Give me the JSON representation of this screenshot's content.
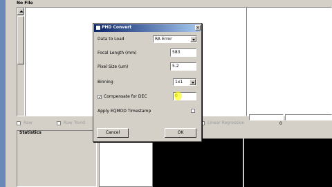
{
  "main": {
    "title": "No File",
    "checkboxes": [
      {
        "label": "Raw"
      },
      {
        "label": "Raw Trend"
      },
      {
        "label": "Linear Regression"
      }
    ],
    "slider_value": "0",
    "statistics_label": "Statistics"
  },
  "dialog": {
    "title": "PHD Convert",
    "data_to_load": {
      "label": "Data to Load",
      "value": "RA Error"
    },
    "focal_length": {
      "label": "Focal Length (mm)",
      "value": "583"
    },
    "pixel_size": {
      "label": "Pixel Size (um)",
      "value": "5.2"
    },
    "binning": {
      "label": "Binning",
      "value": "1x1"
    },
    "compensate": {
      "label": "Compensate for DEC",
      "checked": true,
      "value": "0"
    },
    "eqmod": {
      "label": "Apply EQMOD Timestamp",
      "checked": false
    },
    "cancel_label": "Cancel",
    "ok_label": "OK"
  }
}
